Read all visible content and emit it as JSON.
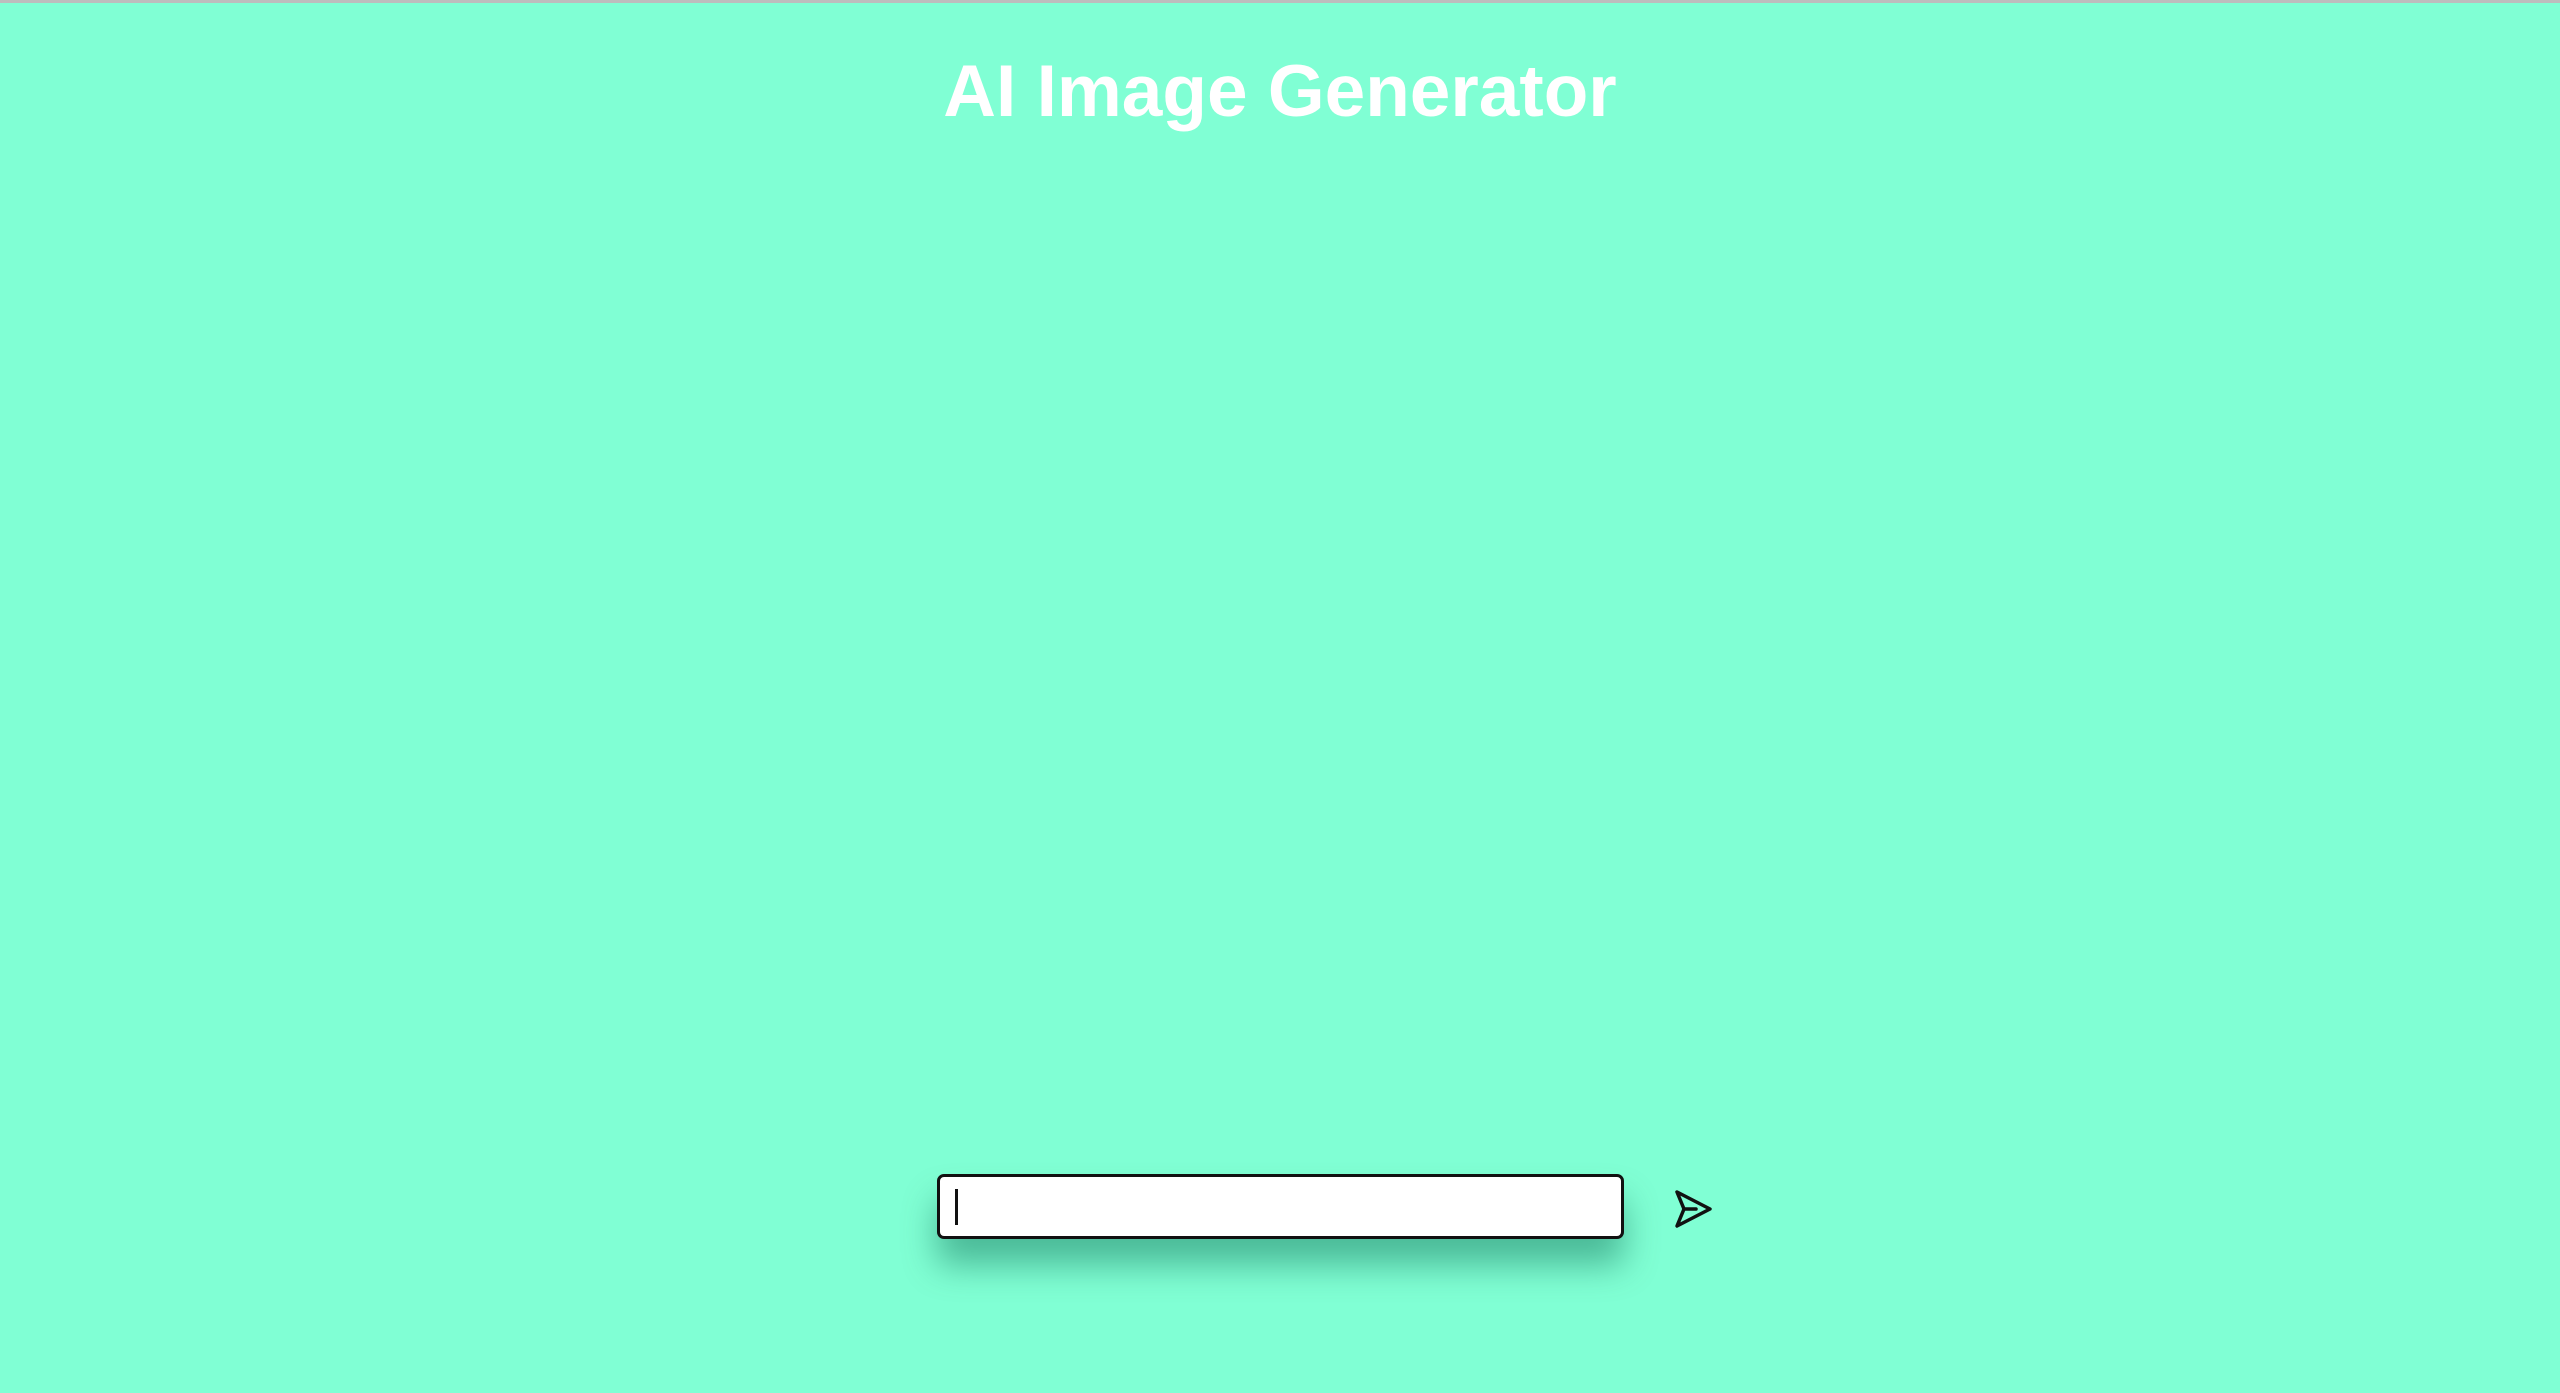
{
  "page": {
    "title": "AI Image Generator",
    "background_color": "#80ffd4",
    "title_color": "#ffffff"
  },
  "prompt": {
    "value": "",
    "placeholder": ""
  },
  "send_button": {
    "icon": "send-icon"
  }
}
